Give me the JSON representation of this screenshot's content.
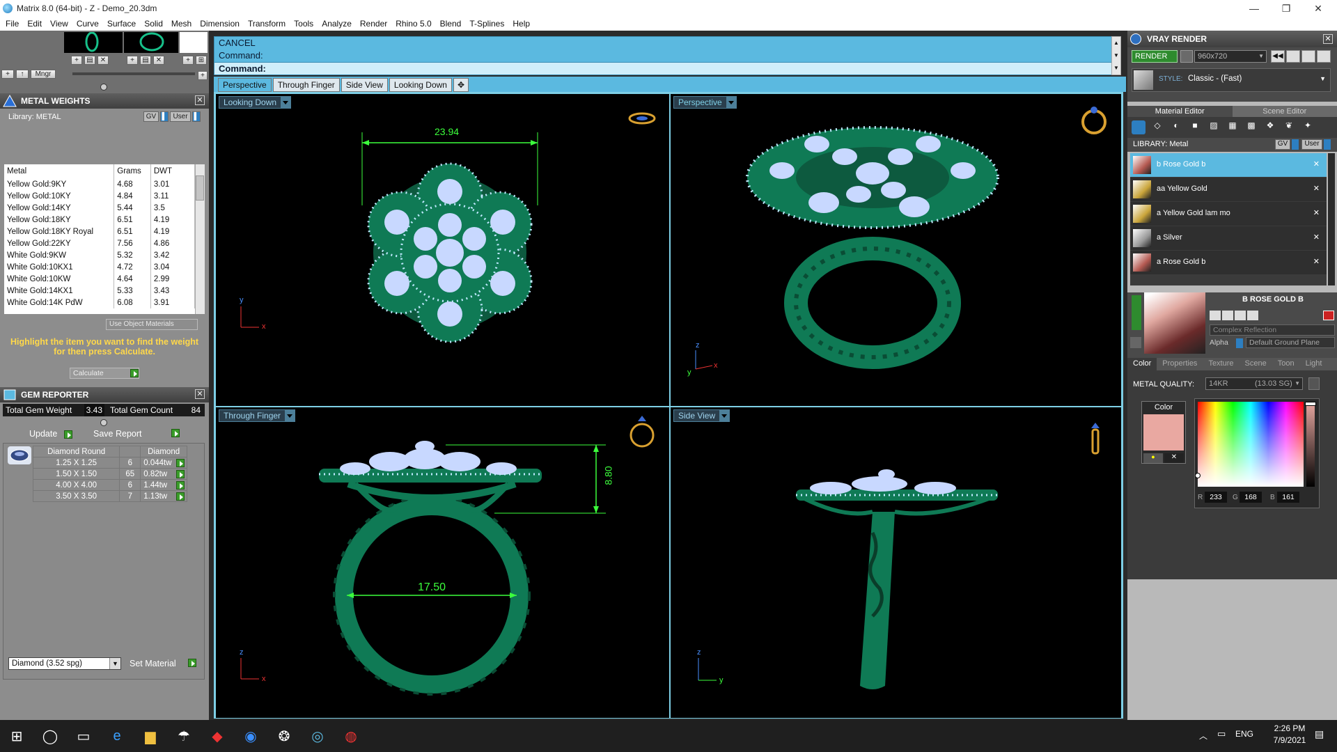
{
  "window": {
    "title": "Matrix 8.0 (64-bit) - Z - Demo_20.3dm",
    "minimize": "—",
    "maximize": "❐",
    "close": "✕"
  },
  "menu": [
    "File",
    "Edit",
    "View",
    "Curve",
    "Surface",
    "Solid",
    "Mesh",
    "Dimension",
    "Transform",
    "Tools",
    "Analyze",
    "Render",
    "Rhino 5.0",
    "Blend",
    "T-Splines",
    "Help"
  ],
  "left_toolbar": {
    "mngr_label": "Mngr"
  },
  "metal_weights": {
    "title": "METAL WEIGHTS",
    "library_label": "Library: METAL",
    "gv_label": "GV",
    "user_label": "User",
    "columns": [
      "Metal",
      "Grams",
      "DWT"
    ],
    "rows": [
      [
        "Yellow Gold:9KY",
        "4.68",
        "3.01"
      ],
      [
        "Yellow Gold:10KY",
        "4.84",
        "3.11"
      ],
      [
        "Yellow Gold:14KY",
        "5.44",
        "3.5"
      ],
      [
        "Yellow Gold:18KY",
        "6.51",
        "4.19"
      ],
      [
        "Yellow Gold:18KY Royal",
        "6.51",
        "4.19"
      ],
      [
        "Yellow Gold:22KY",
        "7.56",
        "4.86"
      ],
      [
        "White Gold:9KW",
        "5.32",
        "3.42"
      ],
      [
        "White Gold:10KX1",
        "4.72",
        "3.04"
      ],
      [
        "White Gold:10KW",
        "4.64",
        "2.99"
      ],
      [
        "White Gold:14KX1",
        "5.33",
        "3.43"
      ],
      [
        "White Gold:14K PdW",
        "6.08",
        "3.91"
      ]
    ],
    "use_object_materials": "Use Object Materials",
    "hint": "Highlight the item you want to find the weight for then press Calculate.",
    "calculate_label": "Calculate"
  },
  "gem_reporter": {
    "title": "GEM REPORTER",
    "total_weight_label": "Total Gem Weight",
    "total_weight_value": "3.43",
    "total_count_label": "Total Gem Count",
    "total_count_value": "84",
    "update_label": "Update",
    "save_report_label": "Save Report",
    "columns": [
      "Diamond Round",
      "",
      "Diamond"
    ],
    "rows": [
      [
        "1.25 X 1.25",
        "6",
        "0.044tw"
      ],
      [
        "1.50 X 1.50",
        "65",
        "0.82tw"
      ],
      [
        "4.00 X 4.00",
        "6",
        "1.44tw"
      ],
      [
        "3.50 X 3.50",
        "7",
        "1.13tw"
      ]
    ],
    "material_select": "Diamond     (3.52 spg)",
    "set_material_label": "Set Material"
  },
  "command": {
    "line1": "CANCEL",
    "line2": "Command:",
    "line3": "Command:"
  },
  "view_tabs": [
    "Perspective",
    "Through Finger",
    "Side View",
    "Looking Down"
  ],
  "viewports": {
    "top_left": {
      "label": "Looking Down",
      "dimension": "23.94",
      "axis_v": "y",
      "axis_h": "x"
    },
    "top_right": {
      "label": "Perspective",
      "axis_v": "z",
      "axis_h": "x",
      "axis_y": "y"
    },
    "bottom_left": {
      "label": "Through Finger",
      "dim_height": "8.80",
      "dim_diameter": "17.50",
      "axis_v": "z",
      "axis_h": "x"
    },
    "bottom_right": {
      "label": "Side View",
      "axis_v": "z",
      "axis_h": "y"
    }
  },
  "vray": {
    "title": "VRAY RENDER",
    "render_label": "RENDER",
    "resolution": "960x720",
    "style_label": "STYLE:",
    "style_value": "Classic - (Fast)",
    "tabs": [
      "Material Editor",
      "Scene Editor"
    ],
    "library_label": "LIBRARY: Metal",
    "gv_label": "GV",
    "user_label": "User",
    "materials": [
      "b Rose Gold b",
      "aa Yellow Gold",
      "a Yellow Gold lam mo",
      "a Silver",
      "a Rose Gold b"
    ],
    "selected_material": "B ROSE GOLD B",
    "reflection": "Complex Reflection",
    "alpha_label": "Alpha",
    "ground": "Default Ground Plane",
    "sub_tabs": [
      "Color",
      "Properties",
      "Texture",
      "Scene",
      "Toon",
      "Light"
    ],
    "metal_quality_label": "METAL QUALITY:",
    "metal_quality_value": "14KR",
    "metal_quality_sg": "(13.03 SG)",
    "color_label": "Color",
    "swatch_color": "#e9a8a1",
    "r_label": "R",
    "r": "233",
    "g_label": "G",
    "g": "168",
    "b_label": "B",
    "b": "161"
  },
  "taskbar": {
    "time": "2:26 PM",
    "date": "7/9/2021",
    "lang": "ENG"
  },
  "colors": {
    "model_green": "#0f7a55",
    "gem": "#c8d8ff",
    "dim_green": "#3cff3c",
    "cmd_blue": "#5bb9e0"
  }
}
